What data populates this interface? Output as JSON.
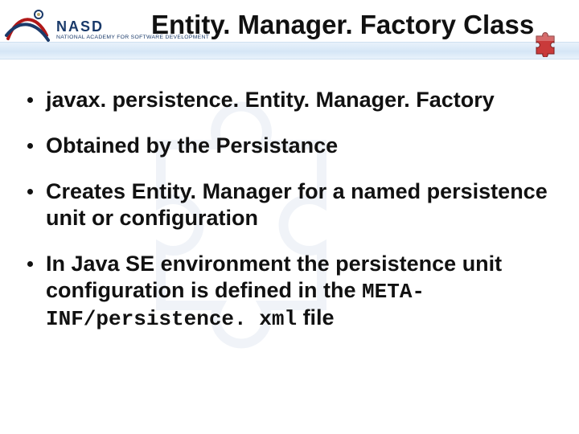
{
  "logo": {
    "name": "NASD",
    "subtitle": "NATIONAL ACADEMY FOR SOFTWARE DEVELOPMENT"
  },
  "title": "Entity. Manager. Factory Class",
  "bullets": [
    {
      "text": "javax. persistence. Entity. Manager. Factory"
    },
    {
      "text": "Obtained by the Persistance"
    },
    {
      "text": "Creates Entity. Manager for a named persistence unit or configuration"
    },
    {
      "pre": "In Java SE environment the persistence unit configuration is defined in the ",
      "code": "META-INF/persistence. xml",
      "post": " file"
    }
  ]
}
